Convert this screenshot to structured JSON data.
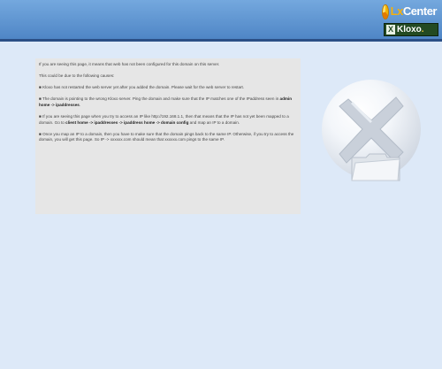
{
  "header": {
    "logo_lx": "Lx",
    "logo_core": "Center",
    "badge_x": "X",
    "badge_name": "Kloxo",
    "badge_suffix": "."
  },
  "message": {
    "intro": "If you are seeing this page, it means that web has not been configured for this domain on this server.",
    "causes_heading": "This could be due to the following causes:",
    "cause1": "Kloxo has not restarted the web server yet after you added the domain. Please wait for the web server to restart.",
    "cause2_a": "The domain is pointing to the wrong Kloxo server. Ping the domain and make sure that the IP matches one of the IPaddress seen in ",
    "cause2_b": "admin home -> ipaddresses",
    "cause2_c": ".",
    "cause3_a": "If you are seeing this page when you try to access an IP like http://192.168.1.1, then that means that the IP has not yet been mapped to a domain. Go to ",
    "cause3_b": "client home -> ipaddresses -> ipaddress home -> domain config",
    "cause3_c": " and map an IP to a domain.",
    "cause4": "Once you map an IP to a domain, then you have to make sure that the domain pings back to the same IP. Otherwise, if you try to access the domain, you will get this page. So IP -> xxxxxx.com should mean that xxxxxx.com pings to the same IP."
  },
  "colors": {
    "header": "#4f86c6",
    "header_border": "#2b4f86",
    "page_bg": "#dde9f8",
    "panel_bg": "#e6e6e6"
  },
  "icons": {
    "globe": "globe-x-icon",
    "folder": "folder-icon"
  }
}
